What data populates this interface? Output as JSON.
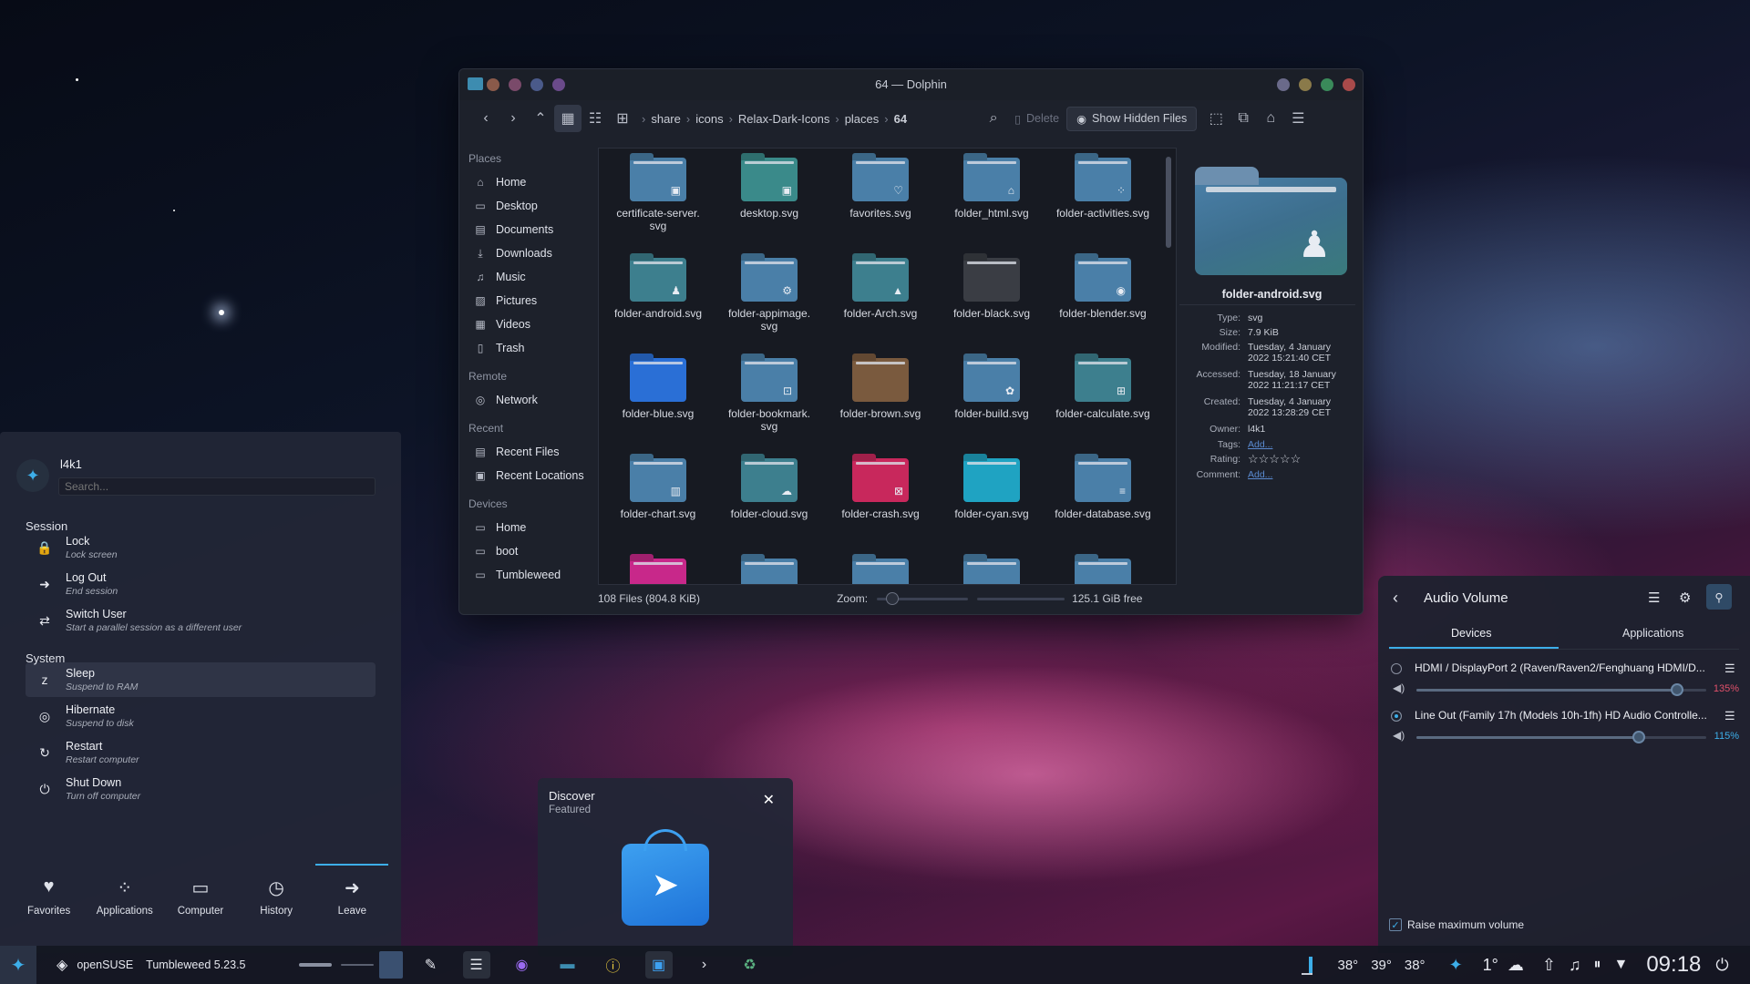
{
  "window": {
    "title": "64 — Dolphin"
  },
  "toolbar": {
    "crumbs": [
      "share",
      "icons",
      "Relax-Dark-Icons",
      "places",
      "64"
    ],
    "delete": "Delete",
    "show_hidden": "Show Hidden Files"
  },
  "places": {
    "head_places": "Places",
    "places": [
      "Home",
      "Desktop",
      "Documents",
      "Downloads",
      "Music",
      "Pictures",
      "Videos",
      "Trash"
    ],
    "head_remote": "Remote",
    "remote": [
      "Network"
    ],
    "head_recent": "Recent",
    "recent": [
      "Recent Files",
      "Recent Locations"
    ],
    "head_devices": "Devices",
    "devices": [
      "Home",
      "boot",
      "Tumbleweed"
    ]
  },
  "files": [
    {
      "name": "certificate-server.\nsvg",
      "color": "#4a7fa8",
      "glyph": "▣"
    },
    {
      "name": "desktop.svg",
      "color": "#3a8a8a",
      "glyph": "▣"
    },
    {
      "name": "favorites.svg",
      "color": "#4a7fa8",
      "glyph": "♡"
    },
    {
      "name": "folder_html.svg",
      "color": "#4a7fa8",
      "glyph": "⌂"
    },
    {
      "name": "folder-activities.svg",
      "color": "#4a7fa8",
      "glyph": "⁘"
    },
    {
      "name": "folder-android.svg",
      "color": "#3d7f8e",
      "glyph": "♟"
    },
    {
      "name": "folder-appimage.\nsvg",
      "color": "#4a7fa8",
      "glyph": "⚙"
    },
    {
      "name": "folder-Arch.svg",
      "color": "#3d7f8e",
      "glyph": "▲"
    },
    {
      "name": "folder-black.svg",
      "color": "#3a3d44",
      "glyph": ""
    },
    {
      "name": "folder-blender.svg",
      "color": "#4a7fa8",
      "glyph": "◉"
    },
    {
      "name": "folder-blue.svg",
      "color": "#2a6fd6",
      "glyph": ""
    },
    {
      "name": "folder-bookmark.\nsvg",
      "color": "#4a7fa8",
      "glyph": "⊡"
    },
    {
      "name": "folder-brown.svg",
      "color": "#7a5a3e",
      "glyph": ""
    },
    {
      "name": "folder-build.svg",
      "color": "#4a7fa8",
      "glyph": "✿"
    },
    {
      "name": "folder-calculate.svg",
      "color": "#3d7f8e",
      "glyph": "⊞"
    },
    {
      "name": "folder-chart.svg",
      "color": "#4a7fa8",
      "glyph": "▥"
    },
    {
      "name": "folder-cloud.svg",
      "color": "#3d7f8e",
      "glyph": "☁"
    },
    {
      "name": "folder-crash.svg",
      "color": "#c8285c",
      "glyph": "⊠"
    },
    {
      "name": "folder-cyan.svg",
      "color": "#1fa3c2",
      "glyph": ""
    },
    {
      "name": "folder-database.svg",
      "color": "#4a7fa8",
      "glyph": "≡"
    },
    {
      "name": "",
      "color": "#c8288a",
      "glyph": ""
    },
    {
      "name": "",
      "color": "#4a7fa8",
      "glyph": ""
    },
    {
      "name": "",
      "color": "#4a7fa8",
      "glyph": ""
    },
    {
      "name": "",
      "color": "#4a7fa8",
      "glyph": ""
    },
    {
      "name": "",
      "color": "#4a7fa8",
      "glyph": ""
    }
  ],
  "info": {
    "name": "folder-android.svg",
    "type_k": "Type:",
    "type": "svg",
    "size_k": "Size:",
    "size": "7.9 KiB",
    "mod_k": "Modified:",
    "mod": "Tuesday, 4 January\n2022 15:21:40 CET",
    "acc_k": "Accessed:",
    "acc": "Tuesday, 18 January\n2022 11:21:17 CET",
    "cre_k": "Created:",
    "cre": "Tuesday, 4 January\n2022 13:28:29 CET",
    "own_k": "Owner:",
    "own": "l4k1",
    "tags_k": "Tags:",
    "tags": "Add...",
    "rat_k": "Rating:",
    "rating": "☆☆☆☆☆",
    "com_k": "Comment:",
    "com": "Add..."
  },
  "status": {
    "count": "108 Files (804.8 KiB)",
    "zoom": "Zoom:",
    "free": "125.1 GiB free"
  },
  "launcher": {
    "user": "l4k1",
    "search_placeholder": "Search...",
    "session": "Session",
    "system": "System",
    "items": [
      {
        "t": "Lock",
        "s": "Lock screen",
        "g": "🔒"
      },
      {
        "t": "Log Out",
        "s": "End session",
        "g": "➜"
      },
      {
        "t": "Switch User",
        "s": "Start a parallel session as a different user",
        "g": "⇄"
      },
      {
        "t": "Sleep",
        "s": "Suspend to RAM",
        "g": "z"
      },
      {
        "t": "Hibernate",
        "s": "Suspend to disk",
        "g": "◎"
      },
      {
        "t": "Restart",
        "s": "Restart computer",
        "g": "↻"
      },
      {
        "t": "Shut Down",
        "s": "Turn off computer",
        "g": "⏻"
      }
    ],
    "tabs": [
      {
        "l": "Favorites",
        "g": "♥"
      },
      {
        "l": "Applications",
        "g": "⁘"
      },
      {
        "l": "Computer",
        "g": "▭"
      },
      {
        "l": "History",
        "g": "◷"
      },
      {
        "l": "Leave",
        "g": "➜"
      }
    ]
  },
  "discover": {
    "title": "Discover",
    "subtitle": "Featured"
  },
  "audio": {
    "title": "Audio Volume",
    "tab_devices": "Devices",
    "tab_apps": "Applications",
    "devices": [
      {
        "name": "HDMI / DisplayPort 2 (Raven/Raven2/Fenghuang HDMI/D...",
        "volume": "135%",
        "level": 1.35
      },
      {
        "name": "Line Out (Family 17h (Models 10h-1fh) HD Audio Controlle...",
        "volume": "115%",
        "level": 1.15
      }
    ],
    "raise": "Raise maximum volume"
  },
  "taskbar": {
    "distro": "openSUSE",
    "version": "Tumbleweed 5.23.5",
    "temps": [
      "38°",
      "39°",
      "38°"
    ],
    "weather": "1°",
    "clock": "09:18"
  }
}
